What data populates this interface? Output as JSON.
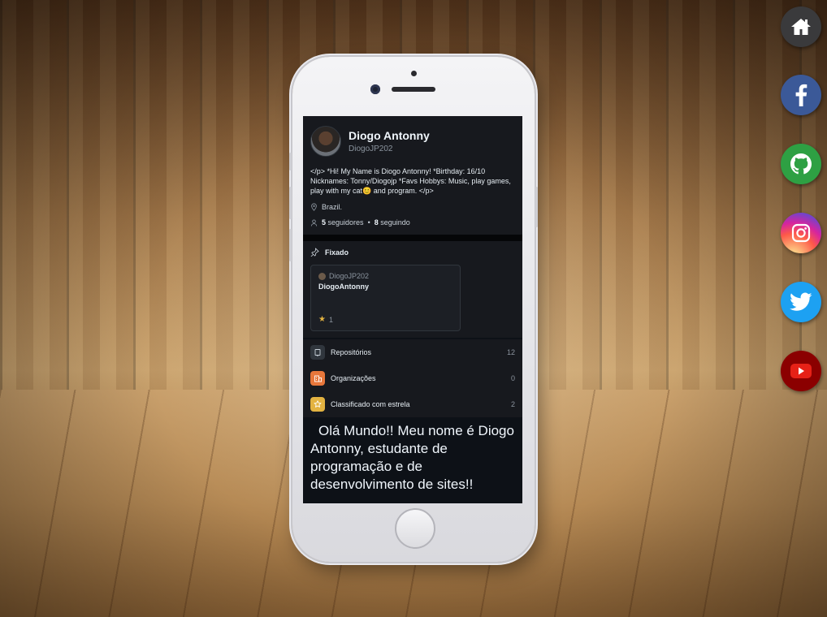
{
  "profile": {
    "name": "Diogo Antonny",
    "login": "DiogoJP202",
    "bio": "</p> *Hi! My Name is Diogo Antonny! *Birthday: 16/10 Nicknames: Tonny/Diogojp *Favs Hobbys: Music, play games, play with my cat😊 and program. </p>",
    "location": "Brazil.",
    "followers_count": "5",
    "followers_label": "seguidores",
    "separator": "•",
    "following_count": "8",
    "following_label": "seguindo"
  },
  "pinned": {
    "title": "Fixado",
    "card": {
      "owner": "DiogoJP202",
      "repo": "DiogoAntonny",
      "stars": "1"
    }
  },
  "list": [
    {
      "label": "Repositórios",
      "count": "12",
      "icon_color": "#30363d",
      "icon": "repo-icon"
    },
    {
      "label": "Organizações",
      "count": "0",
      "icon_color": "#e8773b",
      "icon": "organization-icon"
    },
    {
      "label": "Classificado com estrela",
      "count": "2",
      "icon_color": "#e3b341",
      "icon": "star-icon"
    }
  ],
  "hello_text": "Olá Mundo!! Meu nome é Diogo Antonny, estudante de programação e de desenvolvimento de sites!!",
  "social": [
    {
      "name": "home",
      "color": "#3a3a3c"
    },
    {
      "name": "facebook",
      "color": "#3b5998"
    },
    {
      "name": "github",
      "color": "#2ea043"
    },
    {
      "name": "instagram",
      "color": "#d6249f"
    },
    {
      "name": "twitter",
      "color": "#1da1f2"
    },
    {
      "name": "youtube",
      "color": "#b00000"
    }
  ]
}
